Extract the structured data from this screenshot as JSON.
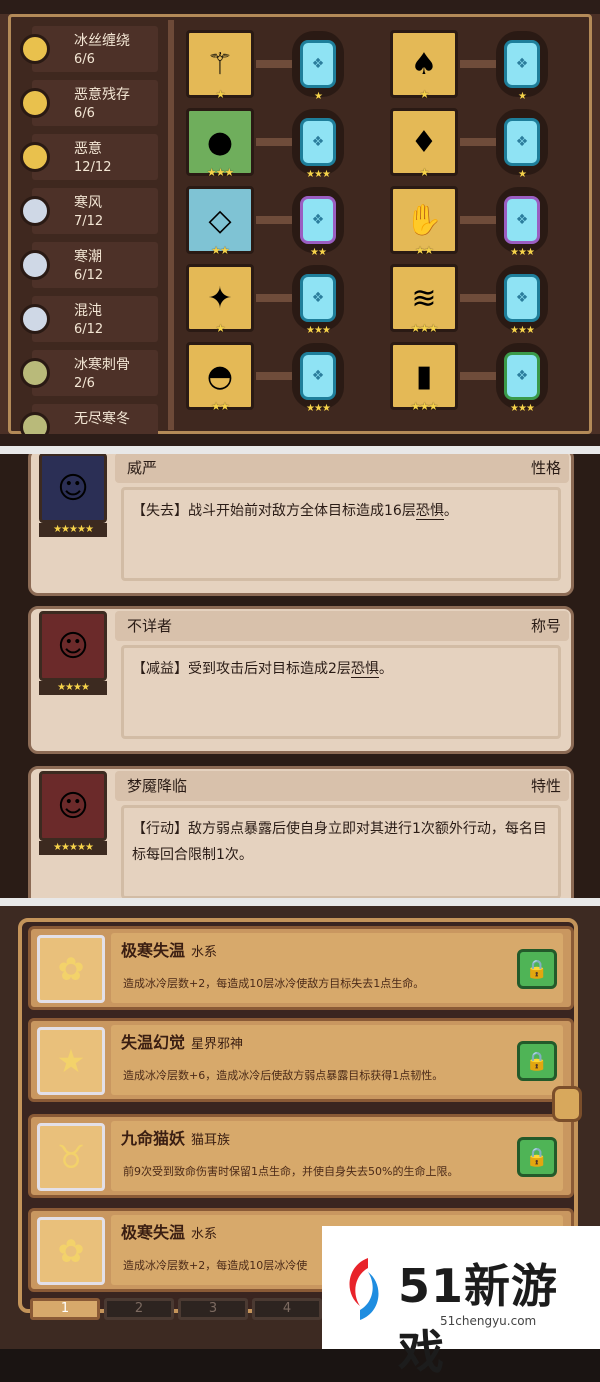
{
  "traits": [
    {
      "name": "冰丝缠绕",
      "count": "6/6",
      "icon_color": "gold"
    },
    {
      "name": "恶意残存",
      "count": "6/6",
      "icon_color": "gold"
    },
    {
      "name": "恶意",
      "count": "12/12",
      "icon_color": "gold"
    },
    {
      "name": "寒风",
      "count": "7/12",
      "icon_color": "silver"
    },
    {
      "name": "寒潮",
      "count": "6/12",
      "icon_color": "silver"
    },
    {
      "name": "混沌",
      "count": "6/12",
      "icon_color": "silver"
    },
    {
      "name": "冰寒刺骨",
      "count": "2/6",
      "icon_color": "olive"
    },
    {
      "name": "无尽寒冬",
      "count": "",
      "icon_color": "olive"
    }
  ],
  "equipment": [
    {
      "left_item": "staff-icon",
      "left_stars": "★",
      "left_bg": "gold",
      "left_gem": "blue",
      "left_gem_stars": "★",
      "right_item": "cloak-icon",
      "right_stars": "★",
      "right_bg": "gold",
      "right_gem": "blue",
      "right_gem_stars": "★"
    },
    {
      "left_item": "pouch-icon",
      "left_stars": "★★★",
      "left_bg": "green",
      "left_gem": "blue",
      "left_gem_stars": "★★★",
      "right_item": "armor-icon",
      "right_stars": "★",
      "right_bg": "gold",
      "right_gem": "blue",
      "right_gem_stars": "★"
    },
    {
      "left_item": "necklace-icon",
      "left_stars": "★★",
      "left_bg": "blue",
      "left_gem": "purple",
      "left_gem_stars": "★★",
      "right_item": "gauntlet-icon",
      "right_stars": "★★",
      "right_bg": "gold",
      "right_gem": "purple",
      "right_gem_stars": "★★★"
    },
    {
      "left_item": "crystal-icon",
      "left_stars": "★",
      "left_bg": "gold",
      "left_gem": "blue",
      "left_gem_stars": "★★★",
      "right_item": "scarf-icon",
      "right_stars": "★★★",
      "right_bg": "gold",
      "right_gem": "blue",
      "right_gem_stars": "★★★"
    },
    {
      "left_item": "helmet-icon",
      "left_stars": "★★",
      "left_bg": "gold",
      "left_gem": "blue",
      "left_gem_stars": "★★★",
      "right_item": "boots-icon",
      "right_stars": "★★★",
      "right_bg": "gold",
      "right_gem": "green",
      "right_gem_stars": "★★★"
    }
  ],
  "characters": [
    {
      "name": "威严",
      "type": "性格",
      "stars": "★★★★★",
      "portrait": "blue",
      "desc_tag": "【失去】",
      "desc_text": "战斗开始前对敌方全体目标造成16层",
      "desc_link": "恐惧",
      "desc_end": "。"
    },
    {
      "name": "不详者",
      "type": "称号",
      "stars": "★★★★",
      "portrait": "red",
      "desc_tag": "【减益】",
      "desc_text": "受到攻击后对目标造成2层",
      "desc_link": "恐惧",
      "desc_end": "。"
    },
    {
      "name": "梦魇降临",
      "type": "特性",
      "stars": "★★★★★",
      "portrait": "red",
      "desc_tag": "【行动】",
      "desc_text": "敌方弱点暴露后使自身立即对其进行1次额外行动，每名目标每回合限制1次。",
      "desc_link": "",
      "desc_end": ""
    }
  ],
  "skills": [
    {
      "name": "极寒失温",
      "sub": "水系",
      "desc": "造成冰冷层数+2，每造成10层冰冷使敌方目标失去1点生命。",
      "icon": "flame-icon"
    },
    {
      "name": "失温幻觉",
      "sub": "星界邪神",
      "desc": "造成冰冷层数+6，造成冰冷后使敌方弱点暴露目标获得1点韧性。",
      "icon": "star-icon"
    },
    {
      "name": "九命猫妖",
      "sub": "猫耳族",
      "desc": "前9次受到致命伤害时保留1点生命，并使自身失去50%的生命上限。",
      "icon": "cat-icon"
    },
    {
      "name": "极寒失温",
      "sub": "水系",
      "desc": "造成冰冷层数+2，每造成10层冰冷使",
      "icon": "flame-icon"
    }
  ],
  "pages": [
    "1",
    "2",
    "3",
    "4"
  ],
  "watermark": {
    "brand": "51新游戏",
    "url": "51chengyu.com"
  }
}
